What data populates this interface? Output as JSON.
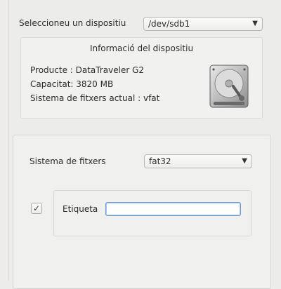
{
  "device": {
    "label": "Seleccioneu un dispositiu",
    "selected": "/dev/sdb1"
  },
  "info": {
    "title": "Informació del dispositiu",
    "product": "Producte : DataTraveler G2",
    "capacity": "Capacitat: 3820 MB",
    "filesystem": "Sistema de fitxers actual : vfat",
    "icon": "hard-drive-icon"
  },
  "format": {
    "fs_label": "Sistema de fitxers",
    "fs_selected": "fat32",
    "label_checkbox_checked": true,
    "label_text": "Etiqueta",
    "label_value": ""
  },
  "colors": {
    "focus": "#6b9bd1"
  }
}
